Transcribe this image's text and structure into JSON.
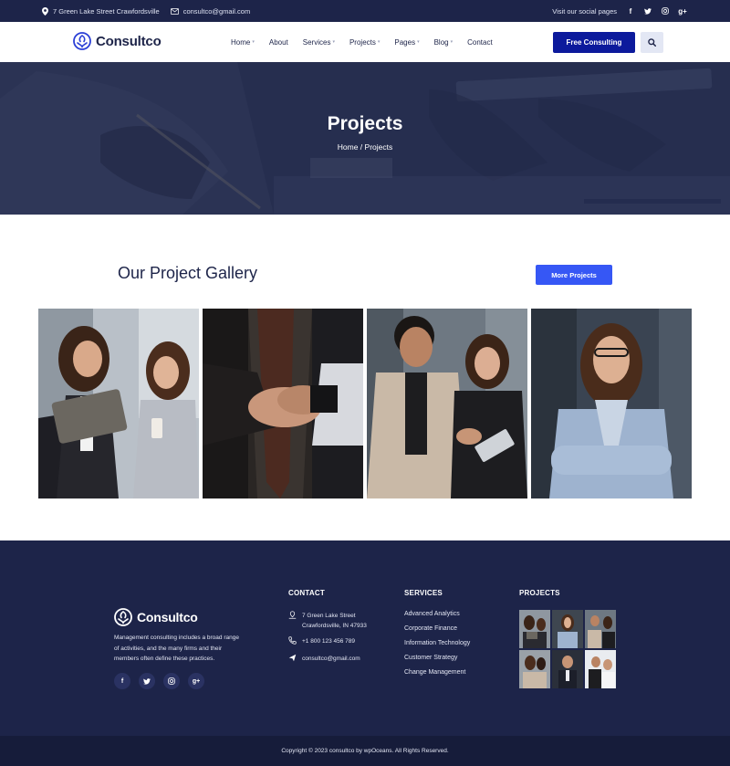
{
  "topbar": {
    "address": "7 Green Lake Street Crawfordsville",
    "email": "consultco@gmail.com",
    "social_label": "Visit our social pages",
    "social_icons": [
      "facebook-icon",
      "twitter-icon",
      "instagram-icon",
      "google-plus-icon"
    ]
  },
  "brand": {
    "name": "Consultco"
  },
  "nav": {
    "items": [
      {
        "label": "Home",
        "has_dropdown": true
      },
      {
        "label": "About",
        "has_dropdown": false
      },
      {
        "label": "Services",
        "has_dropdown": true
      },
      {
        "label": "Projects",
        "has_dropdown": true
      },
      {
        "label": "Pages",
        "has_dropdown": true
      },
      {
        "label": "Blog",
        "has_dropdown": true
      },
      {
        "label": "Contact",
        "has_dropdown": false
      }
    ],
    "cta": "Free Consulting"
  },
  "hero": {
    "title": "Projects",
    "breadcrumb": "Home / Projects"
  },
  "gallery": {
    "title": "Our Project Gallery",
    "more_button": "More Projects"
  },
  "footer": {
    "about": "Management consulting includes a broad range of activities, and the many firms and their members often define these practices.",
    "contact_title": "CONTACT",
    "address_line1": "7 Green Lake Street",
    "address_line2": "Crawfordsville, IN 47933",
    "phone": "+1 800 123 456 789",
    "email": "consultco@gmail.com",
    "services_title": "SERVICES",
    "services": [
      "Advanced Analytics",
      "Corporate Finance",
      "Information Technology",
      "Customer Strategy",
      "Change Management"
    ],
    "projects_title": "PROJECTS",
    "copyright": "Copyright © 2023 consultco by wpOceans. All Rights Reserved."
  },
  "colors": {
    "navy": "#1d2449",
    "primary_button": "#0c1a9c",
    "accent_blue": "#3657f5"
  }
}
